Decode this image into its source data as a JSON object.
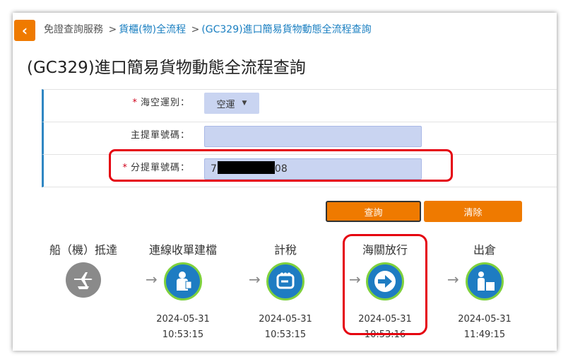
{
  "breadcrumb": {
    "root": "免證查詢服務",
    "sep1": ">",
    "level1": "貨櫃(物)全流程",
    "sep2": ">",
    "level2": "(GC329)進口簡易貨物動態全流程查詢"
  },
  "page_title": "(GC329)進口簡易貨物動態全流程查詢",
  "form": {
    "transport": {
      "required_mark": "*",
      "label": "海空運別：",
      "value": "空運"
    },
    "master_bill": {
      "label": "主提單號碼：",
      "value": ""
    },
    "house_bill": {
      "required_mark": "*",
      "label": "分提單號碼：",
      "value_prefix": "7",
      "value_suffix": "08"
    }
  },
  "buttons": {
    "query": "查詢",
    "clear": "清除"
  },
  "steps": [
    {
      "label": "船（機）抵達",
      "icon": "plane-ship-icon",
      "date": "",
      "time": ""
    },
    {
      "label": "連線收單建檔",
      "icon": "person-document-icon",
      "date": "2024-05-31",
      "time": "10:53:15"
    },
    {
      "label": "計稅",
      "icon": "tax-calc-icon",
      "date": "2024-05-31",
      "time": "10:53:15"
    },
    {
      "label": "海關放行",
      "icon": "arrow-right-icon",
      "date": "2024-05-31",
      "time": "10:53:16"
    },
    {
      "label": "出倉",
      "icon": "person-boxes-icon",
      "date": "2024-05-31",
      "time": "11:49:15"
    }
  ],
  "colors": {
    "accent": "#ef7a00",
    "link": "#1a7fc1",
    "highlight": "#e5000f",
    "step_done": "#1e7cc2",
    "step_ring": "#7fd13d"
  }
}
